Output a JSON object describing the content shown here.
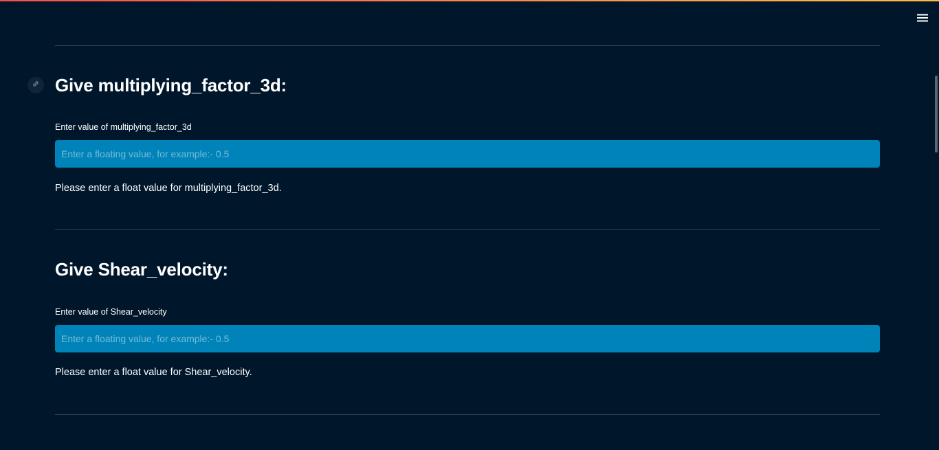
{
  "colors": {
    "background": "#00172b",
    "input_background": "#0083b8",
    "text": "#ffffff",
    "gradient_start": "#ff4b4b",
    "gradient_end": "#ffbd45"
  },
  "header": {
    "menu_icon": "hamburger-menu-icon"
  },
  "sections": [
    {
      "heading": "Give multiplying_factor_3d:",
      "anchor_icon": "link-icon",
      "label": "Enter value of multiplying_factor_3d",
      "placeholder": "Enter a floating value, for example:- 0.5",
      "value": "",
      "message": "Please enter a float value for multiplying_factor_3d."
    },
    {
      "heading": "Give Shear_velocity:",
      "label": "Enter value of Shear_velocity",
      "placeholder": "Enter a floating value, for example:- 0.5",
      "value": "",
      "message": "Please enter a float value for Shear_velocity."
    }
  ]
}
